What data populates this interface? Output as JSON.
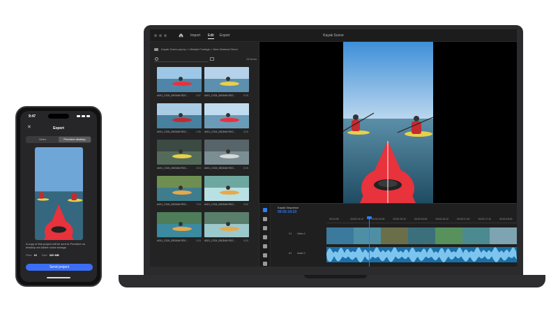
{
  "laptop": {
    "nav": {
      "import": "Import",
      "edit": "Edit",
      "export": "Export"
    },
    "window_title": "Kayak Scene",
    "media": {
      "path": "Kayak Scene.prproj > Lifestyle Footage > New Zealand Shoot",
      "item_count": "15 items",
      "clips": [
        {
          "name": "A001_C024_0503AM.RDC...",
          "duration": "2:47"
        },
        {
          "name": "A001_C024_0503AM.RDC...",
          "duration": "3:15"
        },
        {
          "name": "A001_C024_0503AM.RDC...",
          "duration": "1:06"
        },
        {
          "name": "A001_C024_0503AM.RDC...",
          "duration": "3:15"
        },
        {
          "name": "A001_C024_0503AM.RDC...",
          "duration": "2:19"
        },
        {
          "name": "A001_C024_0503AM.RDC...",
          "duration": "3:15"
        },
        {
          "name": "A001_C024_0503AM.RDC...",
          "duration": "7:15"
        },
        {
          "name": "A001_C024_0503AM.RDC...",
          "duration": "4:02"
        },
        {
          "name": "A001_C024_0503AM.RDC...",
          "duration": "2:15"
        },
        {
          "name": "A001_C024_0503AM.RDC...",
          "duration": "3:15"
        }
      ]
    },
    "timeline": {
      "sequence_name": "Kayak Sequence",
      "timecode": "00:02:14:23",
      "ruler": [
        "00:14:05",
        "00:02:14:12",
        "00:02:15:00",
        "00:02:15:12",
        "00:02:16:00",
        "00:02:16:12",
        "00:02:17:00",
        "00:02:17:12",
        "00:02:18:00"
      ],
      "video_track": "Video 1",
      "video_track_id": "V1",
      "audio_track": "Audio 1",
      "audio_track_id": "A1"
    }
  },
  "phone": {
    "time": "9:47",
    "title": "Export",
    "tabs": [
      "Video",
      "Premiere desktop"
    ],
    "description": "A copy of this project will be sent to Premiere on desktop via Adobe cloud storage.",
    "files_label": "Files",
    "files_value": "16",
    "size_label": "Size",
    "size_value": "320 MB",
    "send_label": "Send project"
  },
  "colors": {
    "accent": "#2d7df6",
    "button": "#3b6ef5",
    "kayak": "#e8323c"
  }
}
